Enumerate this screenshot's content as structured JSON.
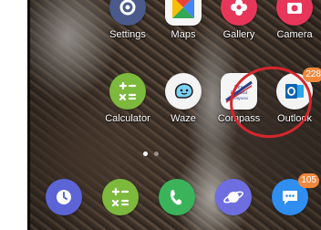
{
  "top_row": [
    {
      "label": "Settings",
      "icon": "gear-icon",
      "color": "#4a5a8a"
    },
    {
      "label": "Maps",
      "icon": "maps-icon",
      "color": "#f6f6f6"
    },
    {
      "label": "Gallery",
      "icon": "flower-icon",
      "color": "#e8365a"
    },
    {
      "label": "Camera",
      "icon": "camera-icon",
      "color": "#e8365a"
    }
  ],
  "middle_row": [
    {
      "label": "Calculator",
      "icon": "calculator-icon",
      "color": "#7cb93d"
    },
    {
      "label": "Waze",
      "icon": "waze-icon",
      "color": "#f3f3f3"
    },
    {
      "label": "Compass",
      "icon": "compass-logo-icon",
      "color": "#f5f5f5",
      "logo_text": "New England Compass"
    },
    {
      "label": "Outlook",
      "icon": "outlook-icon",
      "color": "#f3f3f3",
      "badge": "228"
    }
  ],
  "dock": [
    {
      "name": "clock",
      "icon": "clock-icon",
      "color": "#5c64d6"
    },
    {
      "name": "calculator",
      "icon": "calculator-icon",
      "color": "#7cb93d"
    },
    {
      "name": "phone",
      "icon": "phone-icon",
      "color": "#3bb35a"
    },
    {
      "name": "internet",
      "icon": "planet-icon",
      "color": "#6e6ee0"
    },
    {
      "name": "messages",
      "icon": "chat-icon",
      "color": "#2f8ef0",
      "badge": "105"
    }
  ],
  "highlight_color": "#d6262d",
  "page_indicator": {
    "pages": 2,
    "current": 1
  }
}
